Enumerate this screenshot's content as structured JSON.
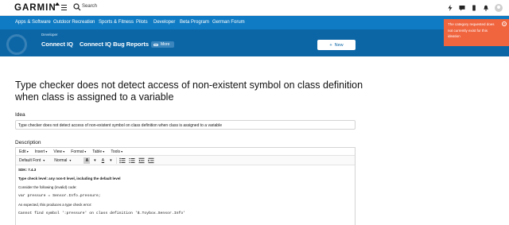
{
  "header": {
    "logo": "GARMIN",
    "search_label": "Search"
  },
  "nav": {
    "items": [
      {
        "label": "Apps & Software"
      },
      {
        "label": "Outdoor Recreation"
      },
      {
        "label": "Sports & Fitness"
      },
      {
        "label": "Pilots"
      },
      {
        "label": "Developer"
      },
      {
        "label": "Beta Program"
      },
      {
        "label": "German Forum"
      }
    ]
  },
  "hero": {
    "breadcrumb": "Developer",
    "title": "Connect IQ",
    "subtitle": "Connect IQ Bug Reports",
    "more_label": "More",
    "new_label": "New"
  },
  "toast": {
    "message": "The category requested does not currently exist for this ideation"
  },
  "page": {
    "title": "Type checker does not detect access of non-existent symbol on class definition when class is assigned to a variable",
    "idea_label": "Idea",
    "idea_value": "Type checker does not detect access of non-existent symbol on class definition when class is assigned to a variable",
    "description_label": "Description"
  },
  "editor": {
    "menus": [
      "Edit",
      "Insert",
      "View",
      "Format",
      "Table",
      "Tools"
    ],
    "font": "Default Font",
    "size": "Normal",
    "lines": [
      {
        "text": "SDK: 7.4.3",
        "style": "b"
      },
      {
        "text": "Type check level: any non-0 level, including the default level",
        "style": "b"
      },
      {
        "text": "Consider the following (invalid) code:",
        "style": ""
      },
      {
        "text": "var pressure = Sensor.Info.pressure;",
        "style": "code"
      },
      {
        "text": "As expected, this produces a type check error:",
        "style": ""
      },
      {
        "text": "Cannot find symbol ':pressure' on class definition '$.Toybox.Sensor.Info'",
        "style": "code"
      }
    ]
  }
}
